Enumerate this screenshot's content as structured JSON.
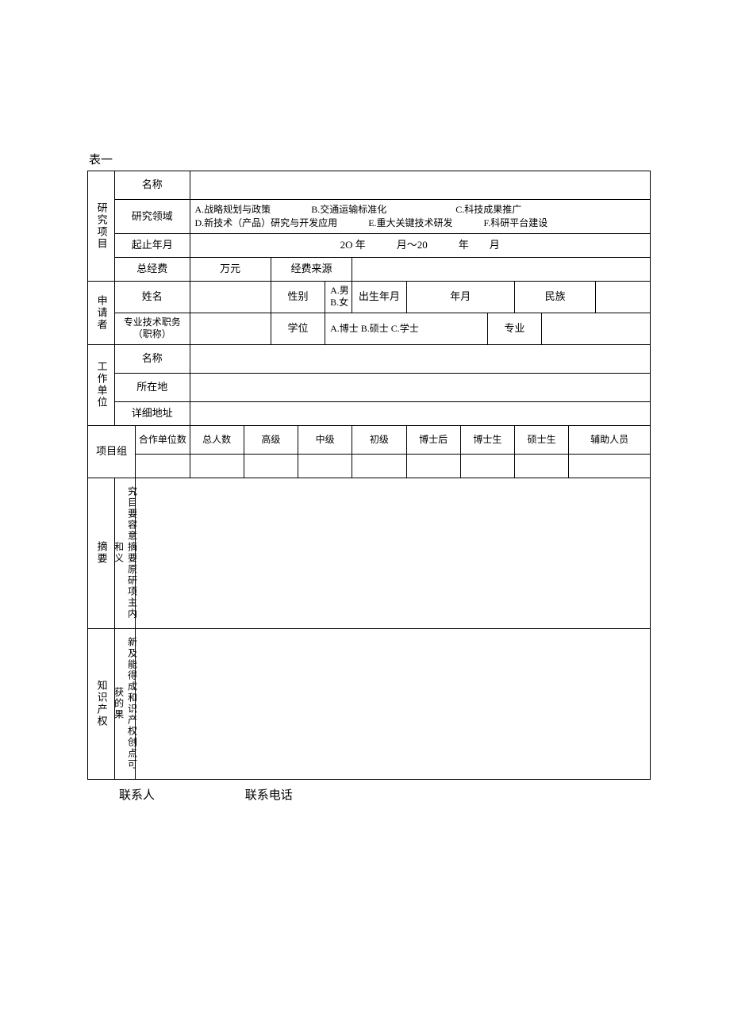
{
  "title": "表一",
  "sections": {
    "project": {
      "header": "研究项目",
      "name_label": "名称",
      "name_value": "",
      "field_label": "研究领域",
      "field_options": {
        "a": "A.战略规划与政策",
        "b": "B.交通运输标准化",
        "c": "C.科技成果推广",
        "d": "D.新技术（产品）研究与开发应用",
        "e": "E.重大关键技术研发",
        "f": "F.科研平台建设"
      },
      "period_label": "起止年月",
      "period_value": "2O 年　　　月～20　　　年　　月",
      "budget_label": "总经费",
      "budget_unit": "万元",
      "fund_source_label": "经费来源",
      "fund_source_value": ""
    },
    "applicant": {
      "header": "申请者",
      "name_label": "姓名",
      "name_value": "",
      "gender_label": "性别",
      "gender_options": {
        "a": "A.男",
        "b": "B.女"
      },
      "dob_label": "出生年月",
      "dob_value": "年月",
      "ethnicity_label": "民族",
      "ethnicity_value": "",
      "title_label": "专业技术职务（职称）",
      "title_value": "",
      "degree_label": "学位",
      "degree_options": "A.博士 B.硕士 C.学士",
      "major_label": "专业",
      "major_value": ""
    },
    "unit": {
      "header": "工作单位",
      "name_label": "名称",
      "name_value": "",
      "location_label": "所在地",
      "location_value": "",
      "address_label": "详细地址",
      "address_value": ""
    },
    "team": {
      "header": "项目组",
      "coop_label": "合作单位数",
      "cols": {
        "total": "总人数",
        "senior": "高级",
        "mid": "中级",
        "junior": "初级",
        "postdoc": "博士后",
        "phd": "博士生",
        "master": "硕士生",
        "aux": "辅助人员"
      },
      "values": {
        "total": "",
        "senior": "",
        "mid": "",
        "junior": "",
        "postdoc": "",
        "phd": "",
        "master": "",
        "aux": ""
      }
    },
    "abstract": {
      "side_label": "摘要",
      "main_label": "究目要容意摘要原研项主内和义",
      "value": ""
    },
    "ip": {
      "side_label": "知识产权",
      "main_label": "新及能得成和识产权创点可获的果",
      "value": ""
    }
  },
  "footer": {
    "contact_label": "联系人",
    "phone_label": "联系电话"
  }
}
